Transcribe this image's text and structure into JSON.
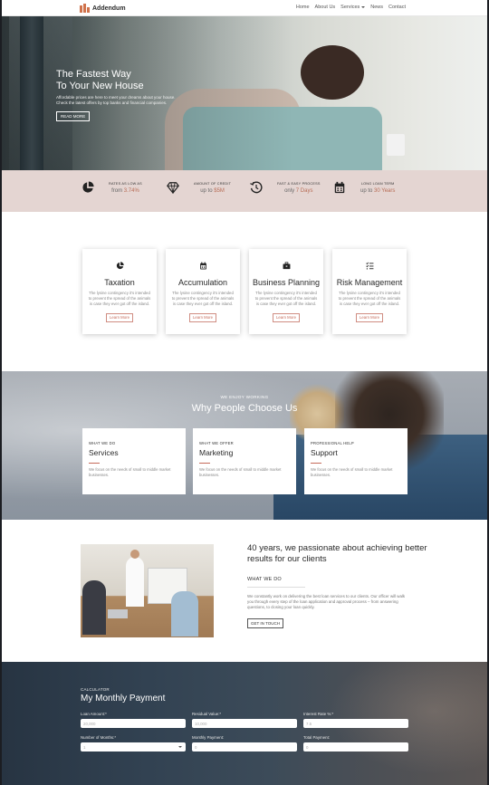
{
  "nav": {
    "brand": "Addendum",
    "items": [
      {
        "label": "Home"
      },
      {
        "label": "About Us"
      },
      {
        "label": "Services"
      },
      {
        "label": "News"
      },
      {
        "label": "Contact"
      }
    ]
  },
  "hero": {
    "title_line1": "The Fastest Way",
    "title_line2": "To Your New House",
    "sub_line1": "Affordable prices are here to meet your dreams about your house.",
    "sub_line2": "Check the latest offers by top banks and financial companies.",
    "button": "READ MORE"
  },
  "stats": [
    {
      "icon": "pie-chart-icon",
      "label": "RATES AS LOW AS",
      "prefix": "from",
      "value": "3.74%"
    },
    {
      "icon": "diamond-icon",
      "label": "AMOUNT OF CREDIT",
      "prefix": "up to",
      "value": "$5M"
    },
    {
      "icon": "history-icon",
      "label": "FAST & EASY PROCESS",
      "prefix": "only",
      "value": "7 Days"
    },
    {
      "icon": "calendar-icon",
      "label": "LONG LOAN TERM",
      "prefix": "up to",
      "value": "30 Years"
    }
  ],
  "services": [
    {
      "icon": "pie-chart-icon",
      "title": "Taxation",
      "text": "The lysine contingency it's intended to prevent the spread of the animals is case they ever got off the island.",
      "button": "Learn More"
    },
    {
      "icon": "calendar-icon",
      "title": "Accumulation",
      "text": "The lysine contingency it's intended to prevent the spread of the animals is case they ever got off the island.",
      "button": "Learn More"
    },
    {
      "icon": "briefcase-icon",
      "title": "Business Planning",
      "text": "The lysine contingency it's intended to prevent the spread of the animals is case they ever got off the island.",
      "button": "Learn More"
    },
    {
      "icon": "checklist-icon",
      "title": "Risk Management",
      "text": "The lysine contingency it's intended to prevent the spread of the animals is case they ever got off the island.",
      "button": "Learn More"
    }
  ],
  "why": {
    "eyebrow": "WE ENJOY WORKING",
    "title": "Why People Choose Us",
    "cards": [
      {
        "sub": "WHAT WE DO",
        "title": "Services",
        "text": "We focus on the needs of small to middle market businesses."
      },
      {
        "sub": "WHAT WE OFFER",
        "title": "Marketing",
        "text": "We focus on the needs of small to middle market businesses."
      },
      {
        "sub": "PROFESSIONAL HELP",
        "title": "Support",
        "text": "We focus on the needs of small to middle market businesses."
      }
    ]
  },
  "about": {
    "title": "40 years, we passionate about achieving better results for our clients",
    "sub": "WHAT WE DO",
    "text": "We constantly work on delivering the best loan services to our clients. Our officer will walk you through every step of the loan application and approval process – from answering questions, to closing your loan quickly.",
    "button": "GET IN TOUCH"
  },
  "calculator": {
    "eyebrow": "CALCULATOR",
    "title": "My Monthly Payment",
    "fields": [
      {
        "label": "Loan Amount:*",
        "value": "20,000"
      },
      {
        "label": "Residual Value:*",
        "value": "10,000"
      },
      {
        "label": "Interest Rate %:*",
        "value": "7.5"
      },
      {
        "label": "Number of Months:*",
        "value": "1"
      },
      {
        "label": "Monthly Payment:",
        "value": "0"
      },
      {
        "label": "Total Payment:",
        "value": "0"
      }
    ]
  }
}
